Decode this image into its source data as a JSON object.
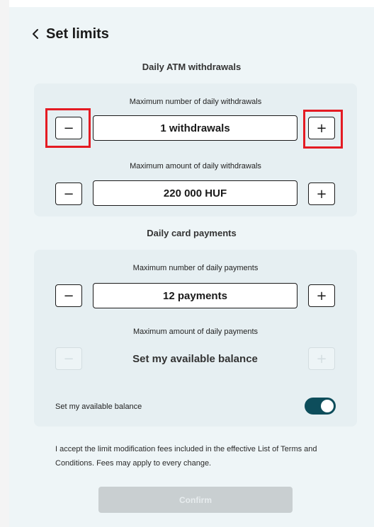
{
  "header": {
    "title": "Set limits"
  },
  "atm": {
    "section_title": "Daily ATM withdrawals",
    "count": {
      "label": "Maximum number of daily withdrawals",
      "value": "1 withdrawals",
      "minus": "−",
      "plus": "+"
    },
    "amount": {
      "label": "Maximum amount of daily withdrawals",
      "value": "220 000 HUF",
      "minus": "−",
      "plus": "+"
    }
  },
  "card_payments": {
    "section_title": "Daily card payments",
    "count": {
      "label": "Maximum number of daily payments",
      "value": "12 payments",
      "minus": "−",
      "plus": "+"
    },
    "amount": {
      "label": "Maximum amount of daily payments",
      "value": "Set my available balance",
      "minus": "−",
      "plus": "+"
    },
    "toggle": {
      "label": "Set my available balance",
      "on": true
    }
  },
  "terms": {
    "text": "I accept the limit modification fees included in the effective List of Terms and Conditions. Fees may apply to every change."
  },
  "confirm": {
    "label": "Confirm"
  },
  "colors": {
    "panel_bg": "#eef5f7",
    "card_bg": "#e6eff2",
    "toggle_on": "#0d4d5b",
    "highlight": "#e41b23",
    "confirm_disabled": "#c9cfd1"
  },
  "icons": {
    "back": "chevron-left-icon"
  }
}
